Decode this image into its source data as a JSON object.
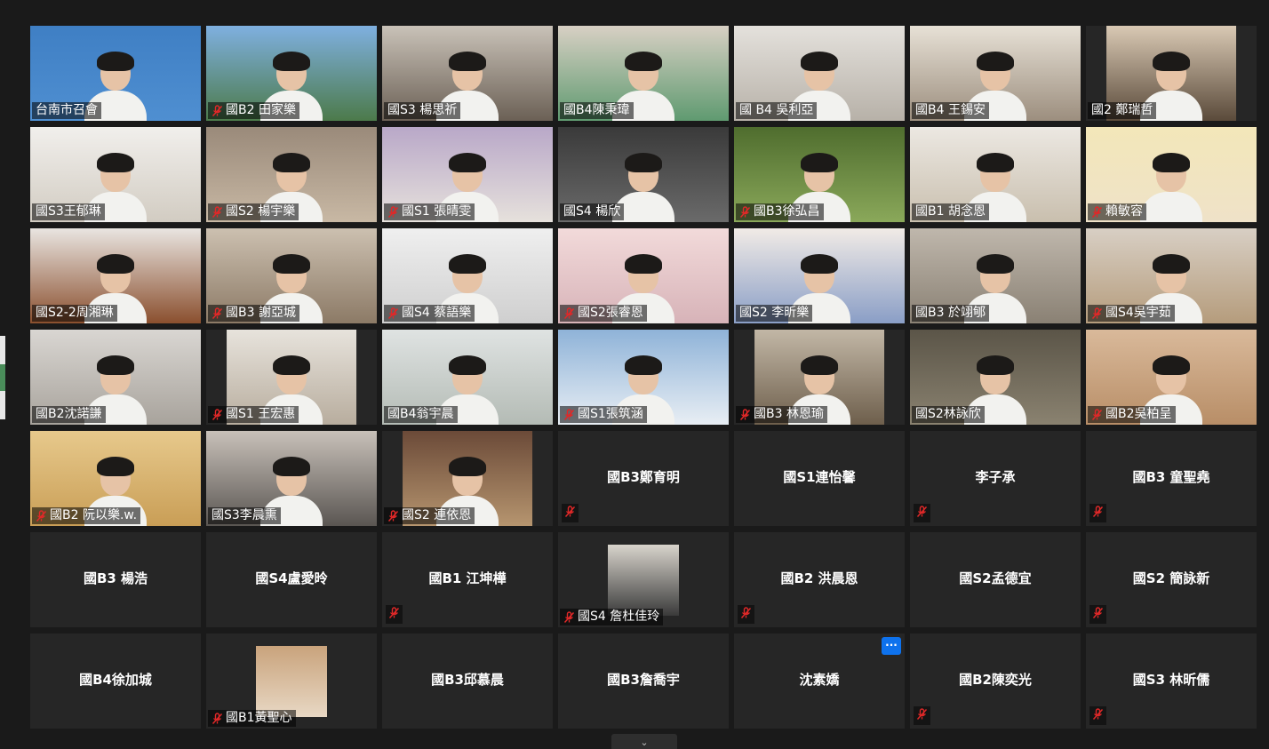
{
  "colors": {
    "background": "#1a1a1a",
    "tile": "#262626",
    "active_border": "#e6e68a",
    "mute_red": "#e02828",
    "more_blue": "#0e72ed"
  },
  "gallery": {
    "participants": [
      {
        "name": "台南市召會",
        "muted": false,
        "video": true,
        "active": true,
        "bg": [
          "#3f7fc4",
          "#4f8fd1"
        ]
      },
      {
        "name": "國B2 田家樂",
        "muted": true,
        "video": true,
        "bg": [
          "#7fb0e0",
          "#4c7a4a"
        ]
      },
      {
        "name": "國S3 楊思祈",
        "muted": false,
        "video": true,
        "bg": [
          "#c9c2b8",
          "#6b6055"
        ]
      },
      {
        "name": "國B4陳秉瑋",
        "muted": false,
        "video": true,
        "bg": [
          "#d8d0c4",
          "#5f9a70"
        ]
      },
      {
        "name": "國 B4 吳利亞",
        "muted": false,
        "video": true,
        "bg": [
          "#e4e1dc",
          "#b7b1a8"
        ]
      },
      {
        "name": "國B4 王錫安",
        "muted": false,
        "video": true,
        "bg": [
          "#e7e1d6",
          "#9c8e7e"
        ]
      },
      {
        "name": "國2 鄭瑞哲",
        "muted": false,
        "video": true,
        "bg": [
          "#d9c9b4",
          "#5a4a3a"
        ],
        "inset": true
      },
      {
        "name": "國S3王郁琳",
        "muted": false,
        "video": true,
        "bg": [
          "#f1efec",
          "#d2ccc2"
        ]
      },
      {
        "name": "國S2 楊宇樂",
        "muted": true,
        "video": true,
        "bg": [
          "#9a8a7a",
          "#c8b8a4"
        ]
      },
      {
        "name": "國S1 張晴雯",
        "muted": true,
        "video": true,
        "bg": [
          "#b9a8c8",
          "#e6e1dc"
        ]
      },
      {
        "name": "國S4 楊欣",
        "muted": false,
        "video": true,
        "bg": [
          "#3a3a3a",
          "#6a6a6a"
        ]
      },
      {
        "name": "國B3徐弘昌",
        "muted": true,
        "video": true,
        "bg": [
          "#4f6d2e",
          "#8aa85a"
        ]
      },
      {
        "name": "國B1 胡念恩",
        "muted": false,
        "video": true,
        "bg": [
          "#ece8e2",
          "#c9bfae"
        ]
      },
      {
        "name": "賴敏容",
        "muted": true,
        "video": true,
        "bg": [
          "#f3e7b9",
          "#efe2c8"
        ]
      },
      {
        "name": "國S2-2周湘琳",
        "muted": false,
        "video": true,
        "bg": [
          "#e9e5e1",
          "#8a4f2e"
        ]
      },
      {
        "name": "國B3 謝亞城",
        "muted": true,
        "video": true,
        "bg": [
          "#ccc0b0",
          "#8c7a66"
        ]
      },
      {
        "name": "國S4 蔡語樂",
        "muted": true,
        "video": true,
        "bg": [
          "#efefef",
          "#cfcfcf"
        ]
      },
      {
        "name": "國S2張睿恩",
        "muted": true,
        "video": true,
        "bg": [
          "#f2dada",
          "#d7b3b8"
        ]
      },
      {
        "name": "國S2 李昕樂",
        "muted": false,
        "video": true,
        "bg": [
          "#f1ebe6",
          "#8a9ec6"
        ]
      },
      {
        "name": "國B3 於翊郇",
        "muted": false,
        "video": true,
        "bg": [
          "#bfb7ac",
          "#8a8174"
        ]
      },
      {
        "name": "國S4吳宇茹",
        "muted": true,
        "video": true,
        "bg": [
          "#d8cfc4",
          "#b59c7c"
        ]
      },
      {
        "name": "國B2沈諾謙",
        "muted": false,
        "video": true,
        "bg": [
          "#d9d6d2",
          "#a8a39c"
        ]
      },
      {
        "name": "國S1 王宏惠",
        "muted": true,
        "video": true,
        "bg": [
          "#e7e3dc",
          "#b8ad9e"
        ],
        "inset": true
      },
      {
        "name": "國B4翁宇晨",
        "muted": false,
        "video": true,
        "bg": [
          "#dfe3e2",
          "#b4bbb5"
        ]
      },
      {
        "name": "國S1張筑涵",
        "muted": true,
        "video": true,
        "bg": [
          "#8fb3d8",
          "#e8eef4"
        ]
      },
      {
        "name": "國B3 林恩瑜",
        "muted": true,
        "video": true,
        "bg": [
          "#c2b7a6",
          "#6e5f4c"
        ],
        "inset": true
      },
      {
        "name": "國S2林詠欣",
        "muted": false,
        "video": true,
        "bg": [
          "#5b5548",
          "#8a8270"
        ]
      },
      {
        "name": "國B2吳柏呈",
        "muted": true,
        "video": true,
        "bg": [
          "#d9b99a",
          "#b88e67"
        ]
      },
      {
        "name": "國B2 阮以樂.w.",
        "muted": true,
        "video": true,
        "bg": [
          "#e7c98c",
          "#c99e56"
        ]
      },
      {
        "name": "國S3李晨熏",
        "muted": false,
        "video": true,
        "bg": [
          "#c8c1b9",
          "#5a5652"
        ]
      },
      {
        "name": "國S2 連依恩",
        "muted": true,
        "video": true,
        "bg": [
          "#6b4a38",
          "#b6956f"
        ],
        "inset": true
      },
      {
        "name": "國B3鄭育明",
        "muted": true,
        "video": false
      },
      {
        "name": "國S1連怡馨",
        "muted": false,
        "video": false
      },
      {
        "name": "李子承",
        "muted": true,
        "video": false
      },
      {
        "name": "國B3 童聖堯",
        "muted": true,
        "video": false
      },
      {
        "name": "國B3 楊浩",
        "muted": false,
        "video": false
      },
      {
        "name": "國S4盧愛昤",
        "muted": false,
        "video": false
      },
      {
        "name": "國B1 江坤樺",
        "muted": true,
        "video": false
      },
      {
        "name": "國S4 詹杜佳玲",
        "muted": true,
        "video": false,
        "photo": "person-photo",
        "photo_bg": [
          "#d8d4cc",
          "#3a3a3a"
        ],
        "tag_name": true
      },
      {
        "name": "國B2 洪晨恩",
        "muted": true,
        "video": false
      },
      {
        "name": "國S2孟德宜",
        "muted": false,
        "video": false
      },
      {
        "name": "國S2 簡詠新",
        "muted": true,
        "video": false
      },
      {
        "name": "國B4徐加城",
        "muted": false,
        "video": false
      },
      {
        "name": "國B1黃聖心",
        "muted": true,
        "video": false,
        "photo": "rabbit-photo",
        "photo_bg": [
          "#c9a37c",
          "#e8d8c4"
        ],
        "tag_name": true
      },
      {
        "name": "國B3邱慕晨",
        "muted": false,
        "video": false
      },
      {
        "name": "國B3詹喬宇",
        "muted": false,
        "video": false
      },
      {
        "name": "沈素嬌",
        "muted": false,
        "video": false,
        "more": true
      },
      {
        "name": "國B2陳奕光",
        "muted": true,
        "video": false
      },
      {
        "name": "國S3 林昕儒",
        "muted": true,
        "video": false
      }
    ]
  },
  "more_button": {
    "label": "···"
  },
  "bottom_handle": {
    "icon": "chevron-down-icon",
    "label": "⌄"
  }
}
